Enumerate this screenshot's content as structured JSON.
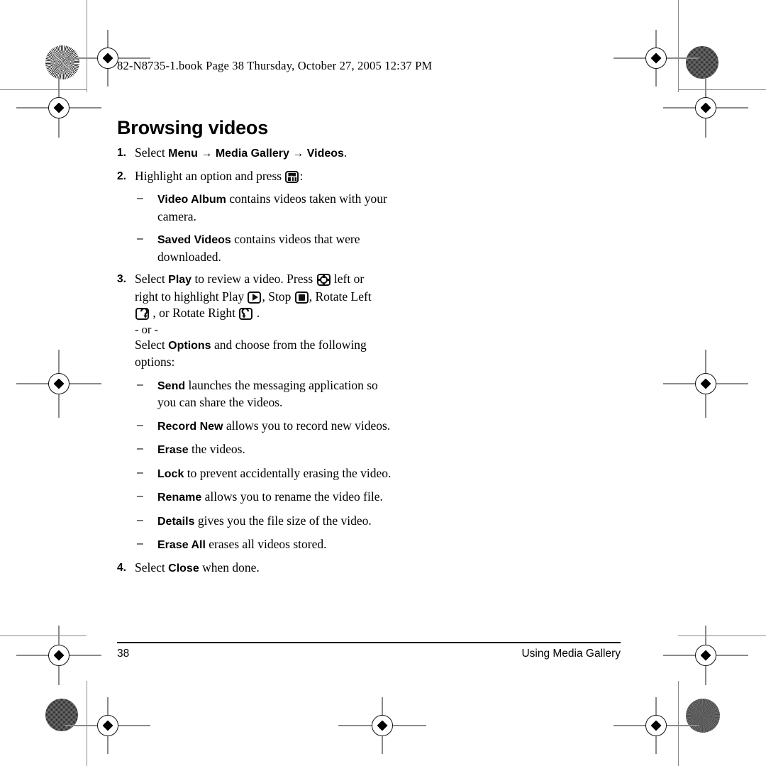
{
  "header": {
    "book_line": "82-N8735-1.book  Page 38  Thursday, October 27, 2005  12:37 PM"
  },
  "title": "Browsing videos",
  "steps": [
    {
      "num": "1.",
      "segments": [
        {
          "t": "Select ",
          "style": "serif"
        },
        {
          "t": "Menu",
          "style": "ui"
        },
        {
          "t": " → ",
          "style": "arrow"
        },
        {
          "t": "Media Gallery",
          "style": "ui"
        },
        {
          "t": " → ",
          "style": "arrow"
        },
        {
          "t": "Videos",
          "style": "ui"
        },
        {
          "t": ".",
          "style": "serif"
        }
      ]
    },
    {
      "num": "2.",
      "segments": [
        {
          "t": "Highlight an option and press ",
          "style": "serif"
        },
        {
          "t": "",
          "style": "icon",
          "icon": "ok-key-icon"
        },
        {
          "t": ":",
          "style": "serif"
        }
      ],
      "subs": [
        {
          "dash": "–",
          "segments": [
            {
              "t": "Video Album",
              "style": "ui"
            },
            {
              "t": " contains videos taken with your camera.",
              "style": "serif"
            }
          ]
        },
        {
          "dash": "–",
          "segments": [
            {
              "t": "Saved Videos",
              "style": "ui"
            },
            {
              "t": " contains videos that were downloaded.",
              "style": "serif"
            }
          ]
        }
      ]
    },
    {
      "num": "3.",
      "segments": [
        {
          "t": "Select ",
          "style": "serif"
        },
        {
          "t": "Play",
          "style": "ui"
        },
        {
          "t": " to review a video. Press ",
          "style": "serif"
        },
        {
          "t": "",
          "style": "icon",
          "icon": "navigation-key-icon"
        },
        {
          "t": " left or right to highlight Play ",
          "style": "serif"
        },
        {
          "t": "",
          "style": "icon",
          "icon": "play-key-icon"
        },
        {
          "t": ", Stop ",
          "style": "serif"
        },
        {
          "t": "",
          "style": "icon",
          "icon": "stop-key-icon"
        },
        {
          "t": ", Rotate Left ",
          "style": "serif"
        },
        {
          "t": "",
          "style": "icon",
          "icon": "rotate-left-key-icon"
        },
        {
          "t": " , or Rotate Right ",
          "style": "serif"
        },
        {
          "t": "",
          "style": "icon",
          "icon": "rotate-right-key-icon"
        },
        {
          "t": " .",
          "style": "serif"
        }
      ],
      "or_text": "- or -",
      "after_or": [
        {
          "t": "Select ",
          "style": "serif"
        },
        {
          "t": "Options",
          "style": "ui"
        },
        {
          "t": " and choose from the following options:",
          "style": "serif"
        }
      ],
      "subs": [
        {
          "dash": "–",
          "segments": [
            {
              "t": "Send",
              "style": "ui"
            },
            {
              "t": " launches the messaging application so you can share the videos.",
              "style": "serif"
            }
          ]
        },
        {
          "dash": "–",
          "segments": [
            {
              "t": "Record New",
              "style": "ui"
            },
            {
              "t": " allows you to record new videos.",
              "style": "serif"
            }
          ]
        },
        {
          "dash": "–",
          "segments": [
            {
              "t": "Erase",
              "style": "ui"
            },
            {
              "t": " the videos.",
              "style": "serif"
            }
          ]
        },
        {
          "dash": "–",
          "segments": [
            {
              "t": "Lock",
              "style": "ui"
            },
            {
              "t": " to prevent accidentally erasing the video.",
              "style": "serif"
            }
          ]
        },
        {
          "dash": "–",
          "segments": [
            {
              "t": "Rename",
              "style": "ui"
            },
            {
              "t": " allows you to rename the video file.",
              "style": "serif"
            }
          ]
        },
        {
          "dash": "–",
          "segments": [
            {
              "t": "Details",
              "style": "ui"
            },
            {
              "t": " gives you the file size of the video.",
              "style": "serif"
            }
          ]
        },
        {
          "dash": "–",
          "segments": [
            {
              "t": "Erase All",
              "style": "ui"
            },
            {
              "t": " erases all videos stored.",
              "style": "serif"
            }
          ]
        }
      ]
    },
    {
      "num": "4.",
      "segments": [
        {
          "t": "Select ",
          "style": "serif"
        },
        {
          "t": "Close",
          "style": "ui"
        },
        {
          "t": " when done.",
          "style": "serif"
        }
      ]
    }
  ],
  "footer": {
    "page_number": "38",
    "section": "Using Media Gallery"
  }
}
